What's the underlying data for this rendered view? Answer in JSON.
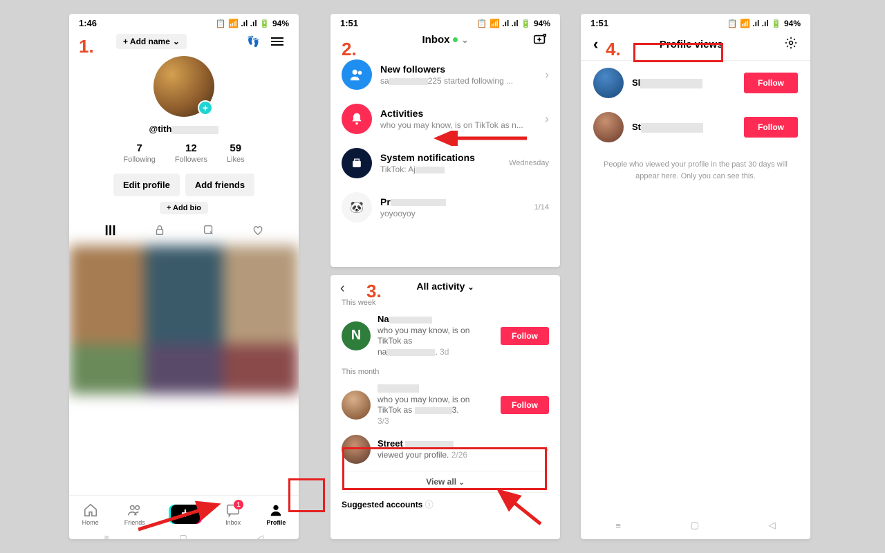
{
  "status": {
    "time1": "1:46",
    "time2": "1:51",
    "time4": "1:51",
    "battery": "94%"
  },
  "step": {
    "s1": "1.",
    "s2": "2.",
    "s3": "3.",
    "s4": "4."
  },
  "screen1": {
    "add_name": "+ Add name",
    "handle_prefix": "@tith",
    "stats": [
      {
        "n": "7",
        "l": "Following"
      },
      {
        "n": "12",
        "l": "Followers"
      },
      {
        "n": "59",
        "l": "Likes"
      }
    ],
    "edit_profile": "Edit profile",
    "add_friends": "Add friends",
    "add_bio": "+ Add bio",
    "nav": {
      "home": "Home",
      "friends": "Friends",
      "inbox": "Inbox",
      "profile": "Profile",
      "badge": "1"
    }
  },
  "screen2": {
    "title": "Inbox",
    "rows": [
      {
        "t": "New followers",
        "s_prefix": "sa",
        "s_suffix": "225 started following ..."
      },
      {
        "t": "Activities",
        "s": "who you may know, is on TikTok as n..."
      },
      {
        "t": "System notifications",
        "s_prefix": "TikTok: Aj",
        "meta": "Wednesday"
      },
      {
        "t_prefix": "Pr",
        "s": "yoyooyoy",
        "meta": "1/14"
      }
    ]
  },
  "screen3": {
    "title": "All activity",
    "sect1": "This week",
    "row1": {
      "name_prefix": "Na",
      "line1": "who you may know, is on",
      "line2": "TikTok as",
      "uname_prefix": "na",
      "time": "3d",
      "follow": "Follow"
    },
    "sect2": "This month",
    "row2": {
      "line1": "who you may know, is on",
      "line2_prefix": "TikTok as ",
      "line2_suffix": "3.",
      "time": "3/3",
      "follow": "Follow"
    },
    "row3": {
      "name_prefix": "Street",
      "line": "viewed your profile.",
      "time": "2/26"
    },
    "viewall": "View all",
    "suggested": "Suggested accounts"
  },
  "screen4": {
    "title": "Profile views",
    "rows": [
      {
        "name_prefix": "Sl",
        "follow": "Follow"
      },
      {
        "name_prefix": "St",
        "follow": "Follow"
      }
    ],
    "note": "People who viewed your profile in the past 30 days will appear here. Only you can see this."
  }
}
